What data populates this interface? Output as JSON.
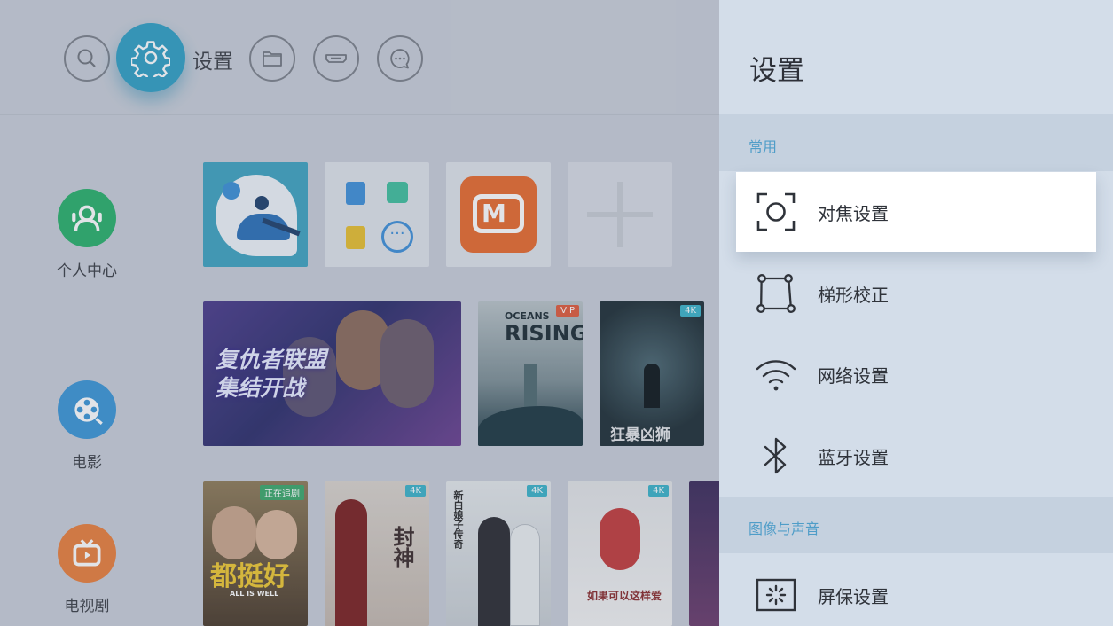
{
  "topbar": {
    "icons": [
      "search-icon",
      "gear-icon",
      "folder-icon",
      "hdmi-icon",
      "message-icon"
    ],
    "active_label": "设置"
  },
  "side_nav": [
    {
      "label": "个人中心",
      "icon": "user-icon",
      "color": "#28b06a"
    },
    {
      "label": "电影",
      "icon": "film-reel-icon",
      "color": "#3a95d6"
    },
    {
      "label": "电视剧",
      "icon": "tv-icon",
      "color": "#ea7e3a"
    }
  ],
  "posters": {
    "avengers": "复仇者联盟\n集结开战",
    "oceans_top": "OCEANS",
    "oceans_bottom": "RISING",
    "oceans_badge": "VIP",
    "monster_badge": "4K",
    "monster_title": "狂暴凶狮",
    "drama1_badge": "正在追剧",
    "drama1_title": "都挺好",
    "drama1_sub": "ALL IS WELL",
    "drama2_badge": "4K",
    "drama2_title": "封神",
    "drama3_badge": "4K",
    "drama3_title": "新白娘子传奇",
    "drama4_badge": "4K",
    "drama4_title": "如果可以这样爱"
  },
  "panel": {
    "title": "设置",
    "sections": [
      {
        "header": "常用",
        "items": [
          {
            "label": "对焦设置",
            "icon": "focus-icon",
            "focused": true
          },
          {
            "label": "梯形校正",
            "icon": "keystone-icon",
            "focused": false
          },
          {
            "label": "网络设置",
            "icon": "wifi-icon",
            "focused": false
          },
          {
            "label": "蓝牙设置",
            "icon": "bluetooth-icon",
            "focused": false
          }
        ]
      },
      {
        "header": "图像与声音",
        "items": [
          {
            "label": "屏保设置",
            "icon": "screensaver-icon",
            "focused": false
          }
        ]
      }
    ]
  },
  "colors": {
    "accent": "#4f9dc8",
    "gear_active": "#2f9fc4",
    "panel_bg": "#d3dde9",
    "section_bg": "#c5d1df",
    "focus_bg": "#ffffff"
  }
}
